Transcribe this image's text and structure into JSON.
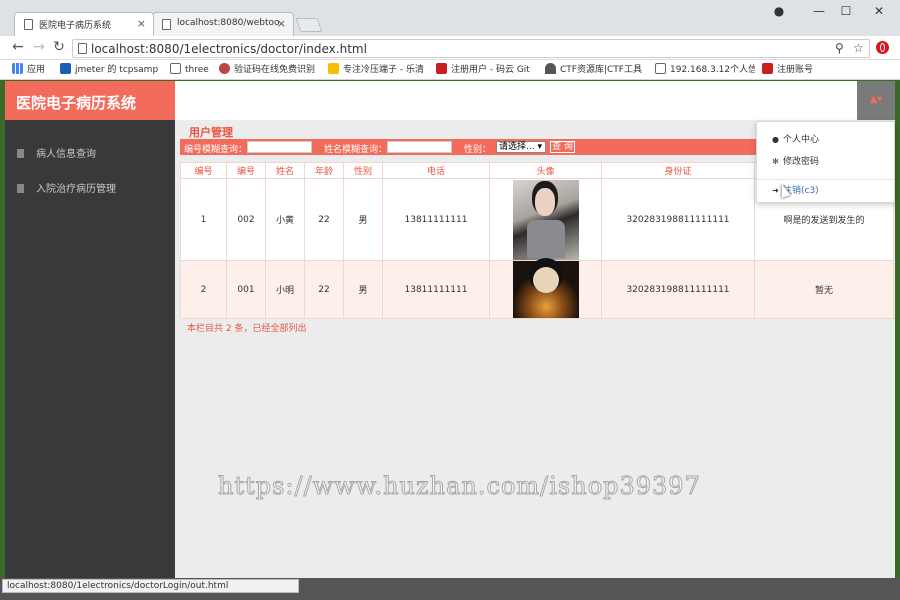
{
  "browser": {
    "tabs": [
      {
        "title": "医院电子病历系统",
        "active": true
      },
      {
        "title": "localhost:8080/webtoo",
        "active": false
      }
    ],
    "url": "localhost:8080/1electronics/doctor/index.html",
    "bookmarks": [
      {
        "label": "应用",
        "icon": "apps-grid-icon"
      },
      {
        "label": "jmeter 的 tcpsampl",
        "icon": "shield-icon"
      },
      {
        "label": "three",
        "icon": "page-icon"
      },
      {
        "label": "验证码在线免费识别",
        "icon": "bug-icon"
      },
      {
        "label": "专注冷压端子 - 乐清",
        "icon": "star-icon"
      },
      {
        "label": "注册用户 - 码云 Git",
        "icon": "gitee-icon"
      },
      {
        "label": "CTF资源库|CTF工具",
        "icon": "person-icon"
      },
      {
        "label": "192.168.3.12个人信",
        "icon": "page-icon"
      },
      {
        "label": "注册账号",
        "icon": "c-logo-icon"
      }
    ],
    "status_url": "localhost:8080/1electronics/doctorLogin/out.html"
  },
  "app": {
    "brand": "医院电子病历系统",
    "sidebar": [
      {
        "label": "病人信息查询"
      },
      {
        "label": "入院治疗病历管理"
      }
    ]
  },
  "main": {
    "title": "用户管理",
    "filters": {
      "id_label": "编号模糊查询：",
      "name_label": "姓名模糊查询：",
      "gender_label": "性别：",
      "gender_value": "请选择...",
      "search_label": "查 询"
    },
    "columns": [
      "编号",
      "编号",
      "姓名",
      "年龄",
      "性别",
      "电话",
      "头像",
      "身份证",
      ""
    ],
    "rows": [
      {
        "no": "1",
        "code": "002",
        "name": "小黄",
        "age": "22",
        "gender": "男",
        "phone": "13811111111",
        "idcard": "320283198811111111",
        "note": "啊是的发送到发生的"
      },
      {
        "no": "2",
        "code": "001",
        "name": "小明",
        "age": "22",
        "gender": "男",
        "phone": "13811111111",
        "idcard": "320283198811111111",
        "note": "暂无"
      }
    ],
    "footer": "本栏目共 2 条，已经全部列出"
  },
  "user_menu": {
    "items": [
      {
        "label": "个人中心",
        "icon": "user-icon"
      },
      {
        "label": "修改密码",
        "icon": "gear-icon"
      },
      {
        "label": "注销(c3)",
        "icon": "logout-icon"
      }
    ]
  },
  "watermark": "https://www.huzhan.com/ishop39397",
  "colors": {
    "accent": "#f26b5b",
    "sidebar": "#393939"
  }
}
